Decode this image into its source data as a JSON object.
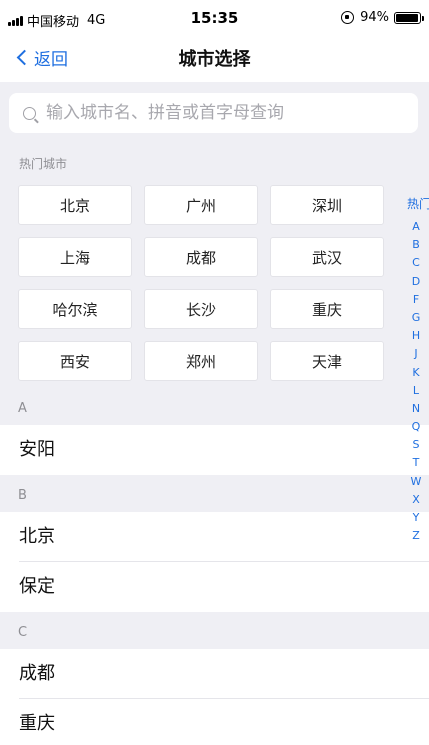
{
  "status_bar": {
    "carrier": "中国移动",
    "network": "4G",
    "time": "15:35",
    "battery": "94%",
    "battery_level": 0.94
  },
  "nav": {
    "back_label": "返回",
    "title": "城市选择"
  },
  "search": {
    "placeholder": "输入城市名、拼音或首字母查询"
  },
  "hot": {
    "label": "热门城市",
    "cities": [
      "北京",
      "广州",
      "深圳",
      "上海",
      "成都",
      "武汉",
      "哈尔滨",
      "长沙",
      "重庆",
      "西安",
      "郑州",
      "天津"
    ]
  },
  "groups": [
    {
      "letter": "A",
      "cities": [
        "安阳"
      ]
    },
    {
      "letter": "B",
      "cities": [
        "北京",
        "保定"
      ]
    },
    {
      "letter": "C",
      "cities": [
        "成都",
        "重庆"
      ]
    }
  ],
  "index": [
    "热门",
    "A",
    "B",
    "C",
    "D",
    "F",
    "G",
    "H",
    "J",
    "K",
    "L",
    "N",
    "Q",
    "S",
    "T",
    "W",
    "X",
    "Y",
    "Z"
  ],
  "colors": {
    "accent": "#1f6fe0",
    "section_bg": "#efeff4"
  }
}
